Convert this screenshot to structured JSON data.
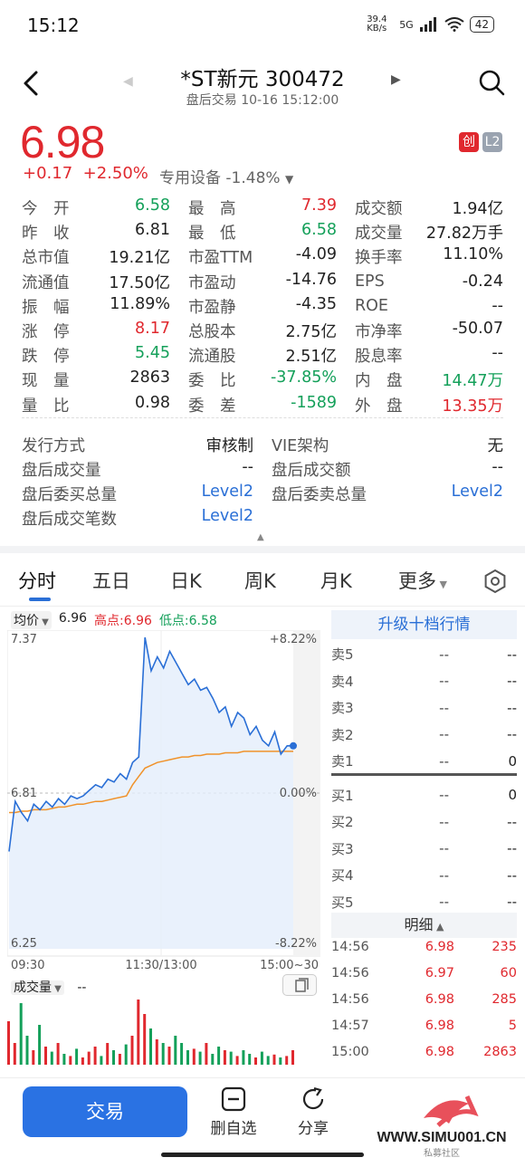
{
  "status": {
    "time": "15:12",
    "network": "39.4 KB/s",
    "signal": "5G",
    "battery": "42"
  },
  "header": {
    "title": "*ST新元 300472",
    "subtitle": "盘后交易 10-16 15:12:00"
  },
  "quote": {
    "price": "6.98",
    "change": "+0.17",
    "change_pct": "+2.50%",
    "sector": "专用设备",
    "sector_pct": "-1.48%",
    "badge_chuang": "创",
    "badge_l2": "L2"
  },
  "stats": [
    [
      {
        "label": "今　开",
        "value": "6.58",
        "color": "green"
      },
      {
        "label": "最　高",
        "value": "7.39",
        "color": "red"
      },
      {
        "label": "成交额",
        "value": "1.94亿",
        "color": "dark"
      }
    ],
    [
      {
        "label": "昨　收",
        "value": "6.81",
        "color": "dark"
      },
      {
        "label": "最　低",
        "value": "6.58",
        "color": "green"
      },
      {
        "label": "成交量",
        "value": "27.82万手",
        "color": "dark"
      }
    ],
    [
      {
        "label": "总市值",
        "value": "19.21亿",
        "color": "dark"
      },
      {
        "label": "市盈TTM",
        "value": "-4.09",
        "color": "dark"
      },
      {
        "label": "换手率",
        "value": "11.10%",
        "color": "dark"
      }
    ],
    [
      {
        "label": "流通值",
        "value": "17.50亿",
        "color": "dark"
      },
      {
        "label": "市盈动",
        "value": "-14.76",
        "color": "dark"
      },
      {
        "label": "EPS",
        "value": "-0.24",
        "color": "dark"
      }
    ],
    [
      {
        "label": "振　幅",
        "value": "11.89%",
        "color": "dark"
      },
      {
        "label": "市盈静",
        "value": "-4.35",
        "color": "dark"
      },
      {
        "label": "ROE",
        "value": "--",
        "color": "dark"
      }
    ],
    [
      {
        "label": "涨　停",
        "value": "8.17",
        "color": "red"
      },
      {
        "label": "总股本",
        "value": "2.75亿",
        "color": "dark"
      },
      {
        "label": "市净率",
        "value": "-50.07",
        "color": "dark"
      }
    ],
    [
      {
        "label": "跌　停",
        "value": "5.45",
        "color": "green"
      },
      {
        "label": "流通股",
        "value": "2.51亿",
        "color": "dark"
      },
      {
        "label": "股息率",
        "value": "--",
        "color": "dark"
      }
    ],
    [
      {
        "label": "现　量",
        "value": "2863",
        "color": "dark"
      },
      {
        "label": "委　比",
        "value": "-37.85%",
        "color": "green"
      },
      {
        "label": "内　盘",
        "value": "14.47万",
        "color": "green"
      }
    ],
    [
      {
        "label": "量　比",
        "value": "0.98",
        "color": "dark"
      },
      {
        "label": "委　差",
        "value": "-1589",
        "color": "green"
      },
      {
        "label": "外　盘",
        "value": "13.35万",
        "color": "red"
      }
    ]
  ],
  "info": [
    [
      {
        "label": "发行方式",
        "value": "审核制",
        "color": "dark"
      },
      {
        "label": "VIE架构",
        "value": "无",
        "color": "dark"
      }
    ],
    [
      {
        "label": "盘后成交量",
        "value": "--",
        "color": "dark"
      },
      {
        "label": "盘后成交额",
        "value": "--",
        "color": "dark"
      }
    ],
    [
      {
        "label": "盘后委买总量",
        "value": "Level2",
        "color": "blue"
      },
      {
        "label": "盘后委卖总量",
        "value": "Level2",
        "color": "blue"
      }
    ],
    [
      {
        "label": "盘后成交笔数",
        "value": "Level2",
        "color": "blue"
      }
    ]
  ],
  "tabs": [
    "分时",
    "五日",
    "日K",
    "周K",
    "月K",
    "更多"
  ],
  "chart_legend": {
    "avg_label": "均价",
    "avg_value": "6.96",
    "high": "高点:6.96",
    "low": "低点:6.58"
  },
  "chart_data": {
    "type": "line",
    "y_left_ticks": [
      "7.37",
      "6.81",
      "6.25"
    ],
    "y_right_ticks": [
      "+8.22%",
      "0.00%",
      "-8.22%"
    ],
    "x_ticks": [
      "09:30",
      "11:30/13:00",
      "15:00~30"
    ],
    "ylim": [
      6.25,
      7.37
    ],
    "prev_close": 6.81,
    "price_series": [
      6.6,
      6.78,
      6.74,
      6.71,
      6.77,
      6.75,
      6.78,
      6.76,
      6.79,
      6.77,
      6.8,
      6.79,
      6.8,
      6.82,
      6.84,
      6.83,
      6.86,
      6.85,
      6.88,
      6.86,
      6.92,
      6.94,
      7.37,
      7.25,
      7.3,
      7.26,
      7.32,
      7.28,
      7.24,
      7.2,
      7.22,
      7.18,
      7.19,
      7.15,
      7.1,
      7.12,
      7.05,
      7.1,
      7.08,
      7.02,
      7.05,
      7.0,
      6.98,
      7.03,
      6.95,
      6.98,
      6.98
    ],
    "avg_series": [
      6.74,
      6.74,
      6.745,
      6.745,
      6.75,
      6.75,
      6.75,
      6.755,
      6.76,
      6.76,
      6.765,
      6.77,
      6.77,
      6.775,
      6.78,
      6.78,
      6.785,
      6.79,
      6.795,
      6.8,
      6.84,
      6.87,
      6.9,
      6.91,
      6.92,
      6.925,
      6.93,
      6.935,
      6.94,
      6.94,
      6.945,
      6.945,
      6.95,
      6.95,
      6.95,
      6.955,
      6.955,
      6.955,
      6.96,
      6.96,
      6.96,
      6.96,
      6.96,
      6.96,
      6.96,
      6.96,
      6.96
    ],
    "volume_series": [
      60,
      30,
      85,
      40,
      20,
      55,
      25,
      18,
      30,
      15,
      12,
      22,
      10,
      18,
      25,
      12,
      30,
      20,
      15,
      28,
      40,
      90,
      70,
      50,
      35,
      30,
      25,
      40,
      30,
      20,
      22,
      18,
      30,
      15,
      25,
      20,
      18,
      12,
      20,
      15,
      10,
      18,
      12,
      14,
      10,
      12,
      20
    ]
  },
  "volume_legend": {
    "label": "成交量",
    "value": "--"
  },
  "order_book": {
    "upgrade": "升级十档行情",
    "asks": [
      {
        "label": "卖5",
        "price": "--",
        "vol": "--"
      },
      {
        "label": "卖4",
        "price": "--",
        "vol": "--"
      },
      {
        "label": "卖3",
        "price": "--",
        "vol": "--"
      },
      {
        "label": "卖2",
        "price": "--",
        "vol": "--"
      },
      {
        "label": "卖1",
        "price": "--",
        "vol": "0"
      }
    ],
    "bids": [
      {
        "label": "买1",
        "price": "--",
        "vol": "0"
      },
      {
        "label": "买2",
        "price": "--",
        "vol": "--"
      },
      {
        "label": "买3",
        "price": "--",
        "vol": "--"
      },
      {
        "label": "买4",
        "price": "--",
        "vol": "--"
      },
      {
        "label": "买5",
        "price": "--",
        "vol": "--"
      }
    ],
    "detail_label": "明细",
    "trades": [
      {
        "time": "14:56",
        "price": "6.98",
        "vol": "235"
      },
      {
        "time": "14:56",
        "price": "6.97",
        "vol": "60"
      },
      {
        "time": "14:56",
        "price": "6.98",
        "vol": "285"
      },
      {
        "time": "14:57",
        "price": "6.98",
        "vol": "5"
      },
      {
        "time": "15:00",
        "price": "6.98",
        "vol": "2863"
      }
    ]
  },
  "bottom": {
    "trade": "交易",
    "remove_watch": "删自选",
    "share": "分享"
  },
  "watermark": {
    "text": "WWW.SIMU001.CN",
    "sub": "私募社区"
  },
  "colors": {
    "red": "#e0282e",
    "green": "#14a05a",
    "blue": "#2a6fd6",
    "avg_line": "#f0922a"
  }
}
